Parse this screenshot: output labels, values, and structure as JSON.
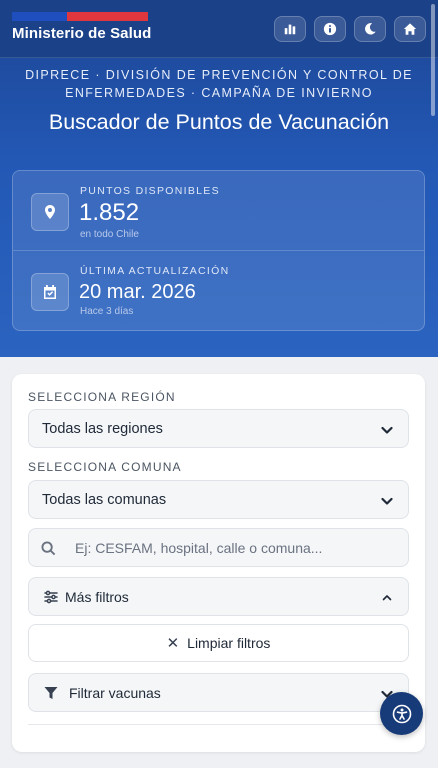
{
  "header": {
    "brand": "Ministerio de Salud",
    "actions": [
      {
        "icon": "bar-chart-icon"
      },
      {
        "icon": "info-icon"
      },
      {
        "icon": "moon-icon"
      },
      {
        "icon": "home-icon"
      }
    ],
    "colors": {
      "flag_blue": "#1f4fbf",
      "flag_red": "#e0363d",
      "header_bg": "#1b4188"
    }
  },
  "hero": {
    "subtitle": "DIPRECE · DIVISIÓN DE PREVENCIÓN Y CONTROL DE ENFERMEDADES · CAMPAÑA DE INVIERNO",
    "title": "Buscador de Puntos de Vacunación"
  },
  "stats": {
    "points": {
      "label": "PUNTOS DISPONIBLES",
      "value": "1.852",
      "note": "en todo Chile",
      "icon": "map-pin-icon"
    },
    "updated": {
      "label": "ÚLTIMA ACTUALIZACIÓN",
      "value": "20 mar. 2026",
      "note": "Hace 3 días",
      "icon": "calendar-check-icon"
    }
  },
  "filters": {
    "region_label": "SELECCIONA REGIÓN",
    "region_value": "Todas las regiones",
    "commune_label": "SELECCIONA COMUNA",
    "commune_value": "Todas las comunas",
    "search_placeholder": "Ej: CESFAM, hospital, calle o comuna...",
    "more_filters_label": "Más filtros",
    "clear_label": "Limpiar filtros",
    "vaccine_filter_label": "Filtrar vacunas"
  },
  "accessibility_button": {
    "icon": "accessibility-icon"
  }
}
